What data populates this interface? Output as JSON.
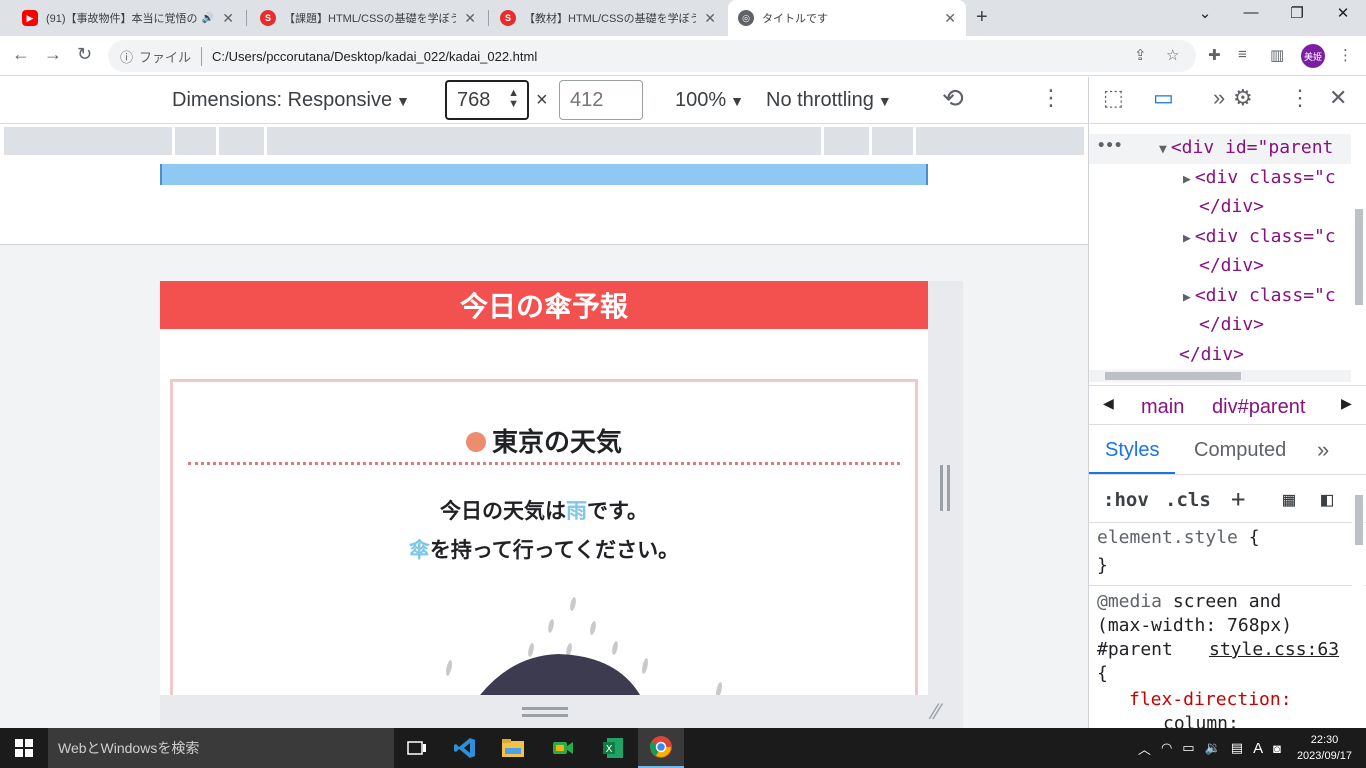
{
  "tabs": [
    {
      "title": "(91)【事故物件】本当に覚悟の",
      "icon": "youtube-icon",
      "audio": true
    },
    {
      "title": "【課題】HTML/CSSの基礎を学ぼう -",
      "icon": "samurai-icon"
    },
    {
      "title": "【教材】HTML/CSSの基礎を学ぼう -",
      "icon": "samurai-icon"
    },
    {
      "title": "タイトルです",
      "icon": "globe-icon",
      "active": true
    }
  ],
  "address": {
    "scheme": "ファイル",
    "path": "C:/Users/pccorutana/Desktop/kadai_022/kadai_022.html"
  },
  "profile_label": "美姫",
  "device_toolbar": {
    "dimensions_label": "Dimensions: Responsive",
    "width_value": "768",
    "times": "×",
    "height_placeholder": "412",
    "zoom": "100%",
    "throttling": "No throttling"
  },
  "page": {
    "header_title": "今日の傘予報",
    "card_title": "東京の天気",
    "forecast_pre": "今日の天気は",
    "forecast_highlight": "雨",
    "forecast_post": "です。",
    "umbrella_highlight": "傘",
    "umbrella_post": "を持って行ってください。"
  },
  "devtools": {
    "elements": {
      "ellipsis": "•••",
      "parent_open": "<div id=\"parent",
      "child_open": "<div class=\"c",
      "close_div": "</div>"
    },
    "breadcrumbs": [
      "main",
      "div#parent"
    ],
    "tabs": [
      "Styles",
      "Computed"
    ],
    "filter": {
      "hov": ":hov",
      "cls": ".cls"
    },
    "styles": {
      "element_style": "element.style",
      "open_brace": "{",
      "close_brace": "}",
      "media_keyword": "@media",
      "media_rest": "screen and",
      "media_cond": "(max-width: 768px)",
      "selector": "#parent",
      "source": "style.css:63",
      "prop_name": "flex-direction:",
      "prop_value": "column;"
    }
  },
  "taskbar": {
    "search_placeholder": "WebとWindowsを検索",
    "ime": "A",
    "time": "22:30",
    "date": "2023/09/17"
  },
  "colors": {
    "header_red": "#f35150",
    "highlight_blue": "#7fc7e8",
    "card_border": "#f0c8ca",
    "title_dot": "#ec8d6f"
  }
}
